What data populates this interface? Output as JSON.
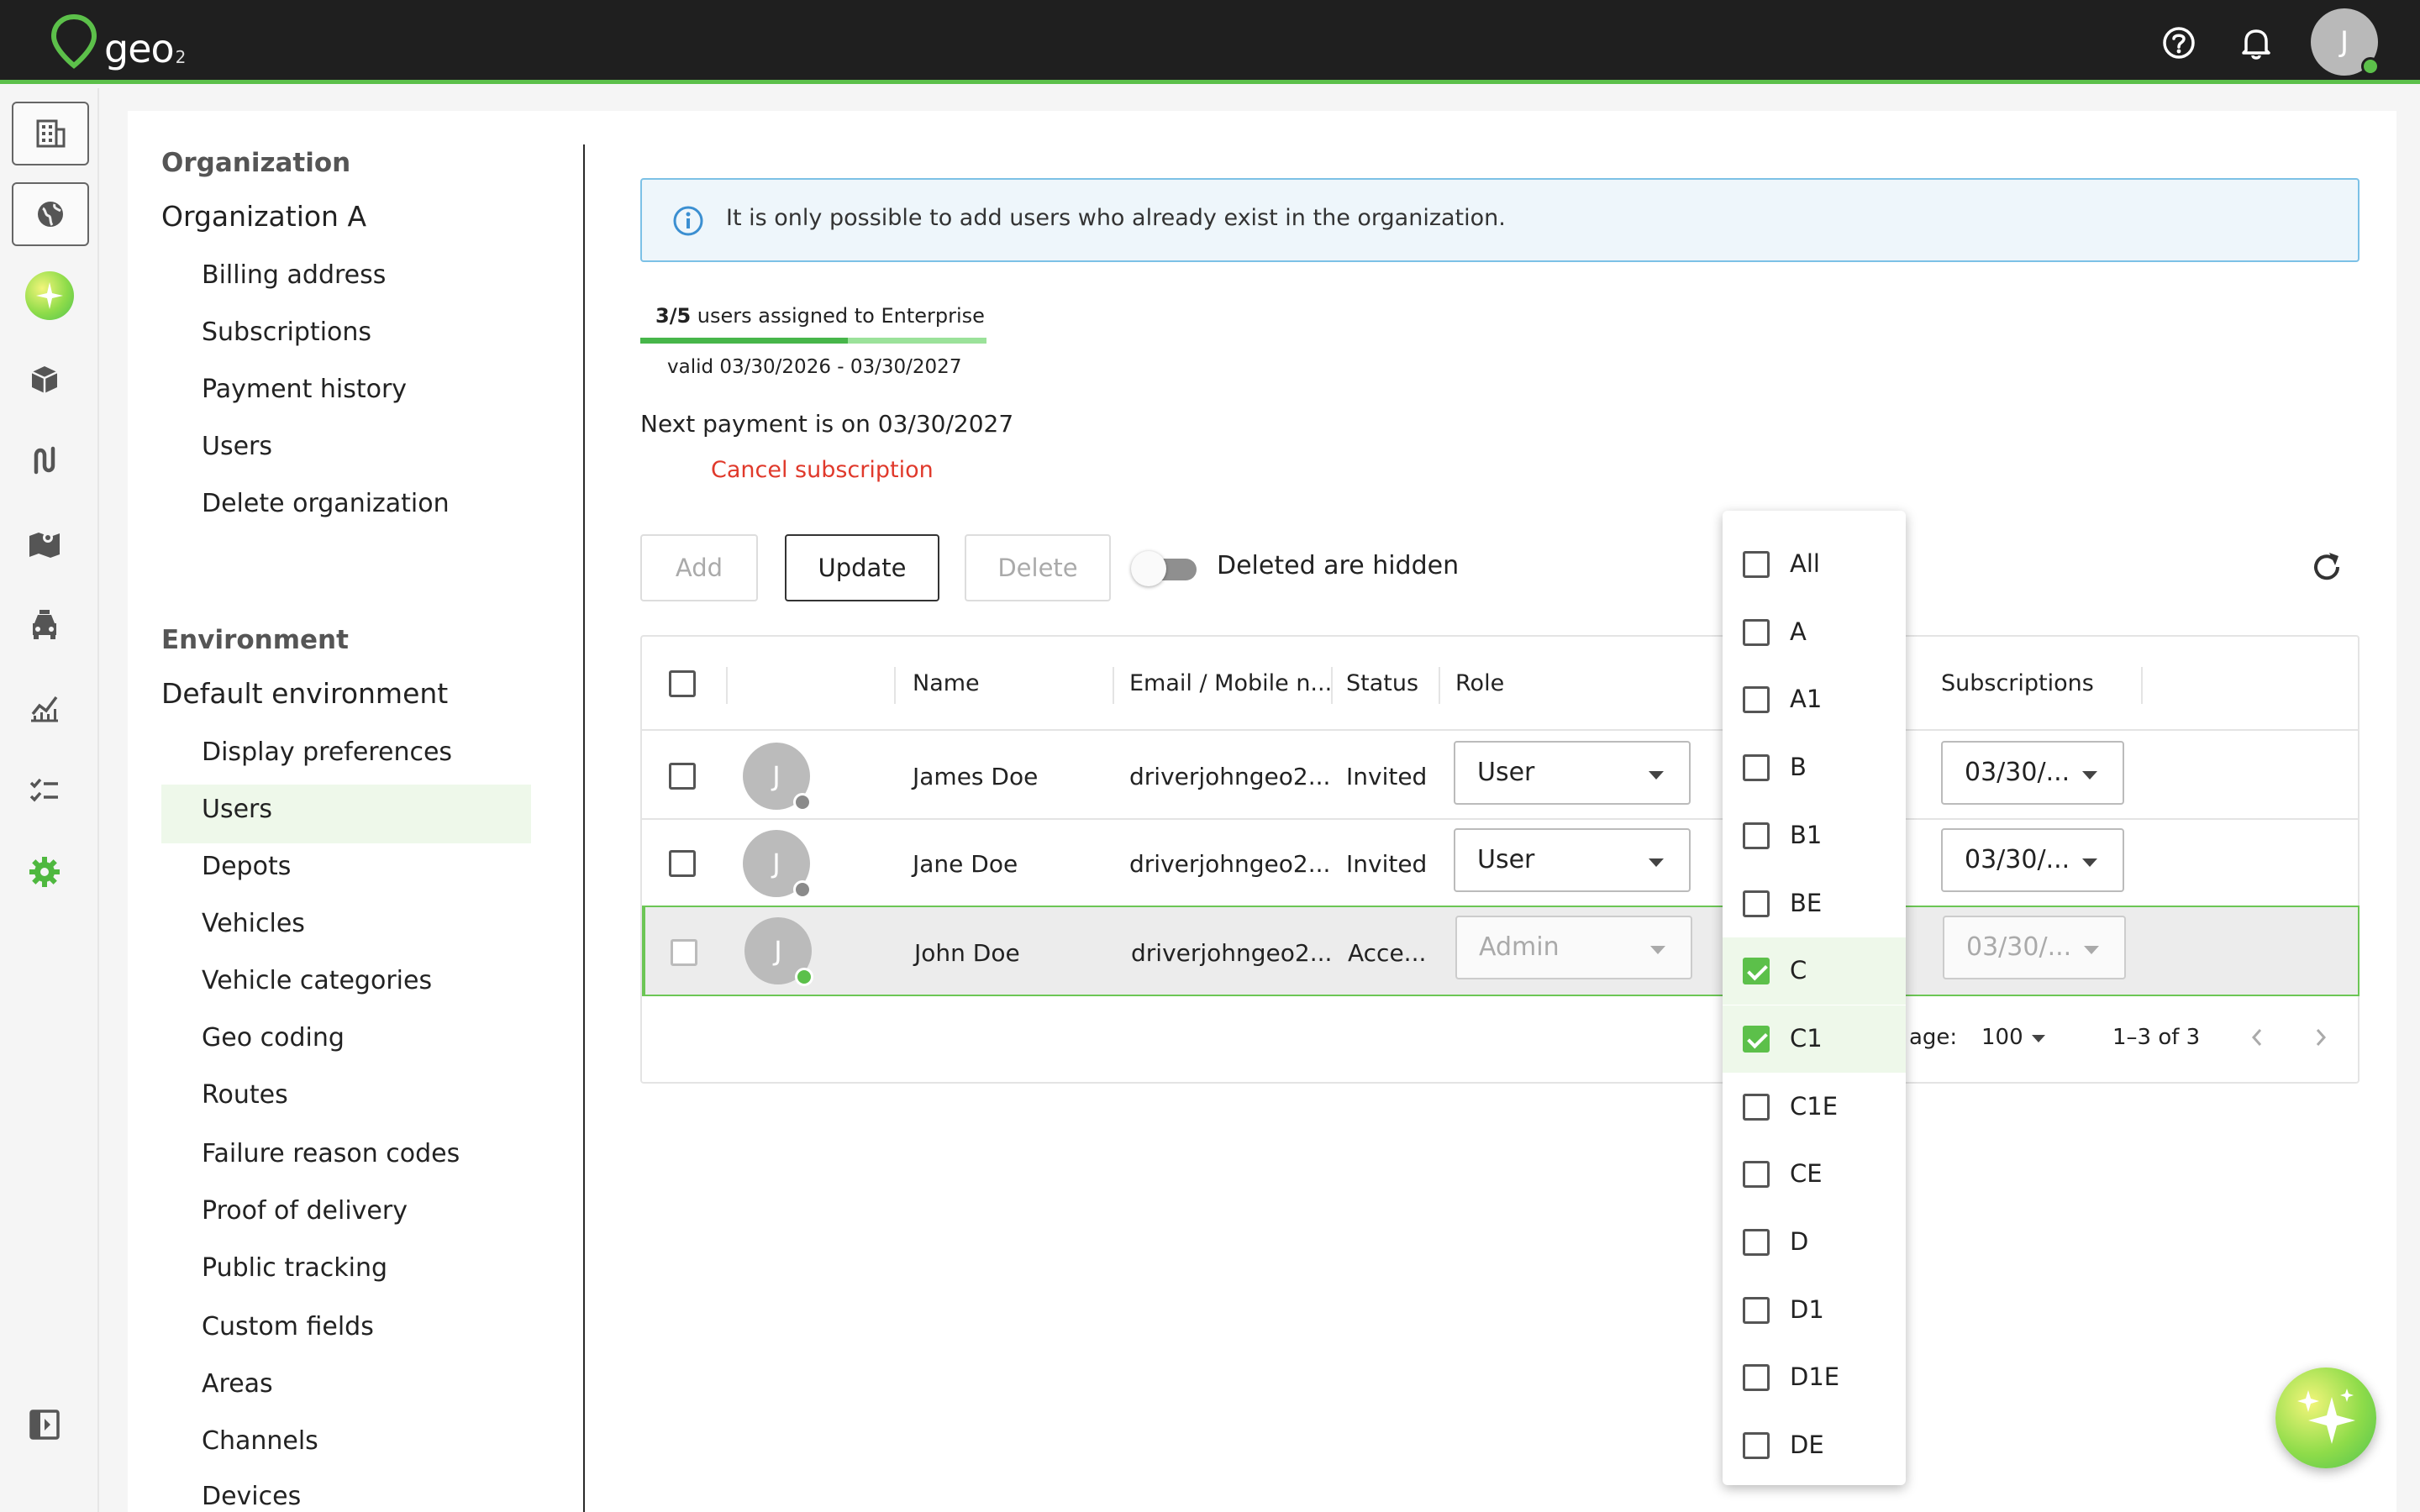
{
  "app": {
    "logo_text": "geo",
    "logo_sub": "2"
  },
  "header": {
    "avatar_initial": "J"
  },
  "nav": {
    "org_section": "Organization",
    "org_title": "Organization A",
    "org_items": [
      "Billing address",
      "Subscriptions",
      "Payment history",
      "Users",
      "Delete organization"
    ],
    "env_section": "Environment",
    "env_title": "Default environment",
    "env_items": [
      "Display preferences",
      "Users",
      "Depots",
      "Vehicles",
      "Vehicle categories",
      "Geo coding",
      "Routes",
      "Failure reason codes",
      "Proof of delivery",
      "Public tracking",
      "Custom fields",
      "Areas",
      "Channels",
      "Devices"
    ],
    "active_item": "Users"
  },
  "info": {
    "text": "It is only possible to add users who already exist in the organization."
  },
  "subscription": {
    "assigned": "3/5",
    "assigned_suffix": " users assigned to Enterprise",
    "progress_fraction": 0.6,
    "valid": "valid 03/30/2026 - 03/30/2027",
    "next_payment": "Next payment is on 03/30/2027",
    "cancel_label": "Cancel subscription"
  },
  "toolbar": {
    "add_label": "Add",
    "update_label": "Update",
    "delete_label": "Delete",
    "toggle_label": "Deleted are hidden",
    "toggle_on": false
  },
  "table": {
    "columns": [
      "Name",
      "Email / Mobile n...",
      "Status",
      "Role",
      "Subscriptions"
    ],
    "rows": [
      {
        "initial": "J",
        "name": "James Doe",
        "email": "driverjohngeo2...",
        "status": "Invited",
        "role": "User",
        "subscription": "03/30/...",
        "online": false
      },
      {
        "initial": "J",
        "name": "Jane Doe",
        "email": "driverjohngeo2...",
        "status": "Invited",
        "role": "User",
        "subscription": "03/30/...",
        "online": false
      },
      {
        "initial": "J",
        "name": "John Doe",
        "email": "driverjohngeo2...",
        "status": "Acce...",
        "role": "Admin",
        "subscription": "03/30/...",
        "online": true
      }
    ],
    "per_page_label": "age:",
    "per_page": "100",
    "range": "1–3 of 3"
  },
  "license_menu": {
    "options": [
      {
        "label": "All",
        "checked": false
      },
      {
        "label": "A",
        "checked": false
      },
      {
        "label": "A1",
        "checked": false
      },
      {
        "label": "B",
        "checked": false
      },
      {
        "label": "B1",
        "checked": false
      },
      {
        "label": "BE",
        "checked": false
      },
      {
        "label": "C",
        "checked": true
      },
      {
        "label": "C1",
        "checked": true
      },
      {
        "label": "C1E",
        "checked": false
      },
      {
        "label": "CE",
        "checked": false
      },
      {
        "label": "D",
        "checked": false
      },
      {
        "label": "D1",
        "checked": false
      },
      {
        "label": "D1E",
        "checked": false
      },
      {
        "label": "DE",
        "checked": false
      }
    ]
  },
  "colors": {
    "brand_green": "#5cc04a",
    "danger": "#e0392b",
    "info_border": "#7cc1e6"
  },
  "icons": {
    "rail": [
      "building-icon",
      "globe-icon",
      "assistant-icon",
      "package-icon",
      "route-icon",
      "map-icon",
      "car-icon",
      "analytics-icon",
      "checklist-icon",
      "gear-icon",
      "collapse-sidebar-icon"
    ],
    "top": [
      "help-icon",
      "bell-icon"
    ]
  }
}
